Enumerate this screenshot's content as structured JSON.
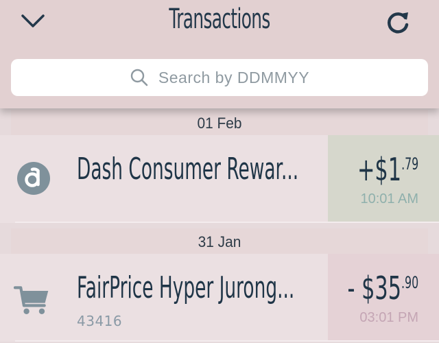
{
  "header": {
    "title": "Transactions",
    "back_icon": "chevron-down-icon",
    "refresh_icon": "refresh-icon"
  },
  "search": {
    "placeholder": "Search by DDMMYY",
    "value": ""
  },
  "colors": {
    "header_bg": "#e2d0d1",
    "text_dark": "#1f3547",
    "credit_bg": "#d6d7cc",
    "debit_bg": "#e5d2d6",
    "credit_time": "#8fb0ac",
    "debit_time": "#c4a5b4"
  },
  "groups": [
    {
      "date": "01 Feb",
      "transactions": [
        {
          "name": "Dash Consumer Rewar...",
          "subtitle": "",
          "icon": "dash-logo-icon",
          "sign": "+",
          "dollars": "$1",
          "cents": ".79",
          "time": "10:01 AM",
          "type": "credit"
        }
      ]
    },
    {
      "date": "31 Jan",
      "transactions": [
        {
          "name": "FairPrice Hyper Jurong...",
          "subtitle": "43416",
          "icon": "shopping-cart-icon",
          "sign": "- ",
          "dollars": "$35",
          "cents": ".90",
          "time": "03:01 PM",
          "type": "debit"
        }
      ]
    }
  ]
}
